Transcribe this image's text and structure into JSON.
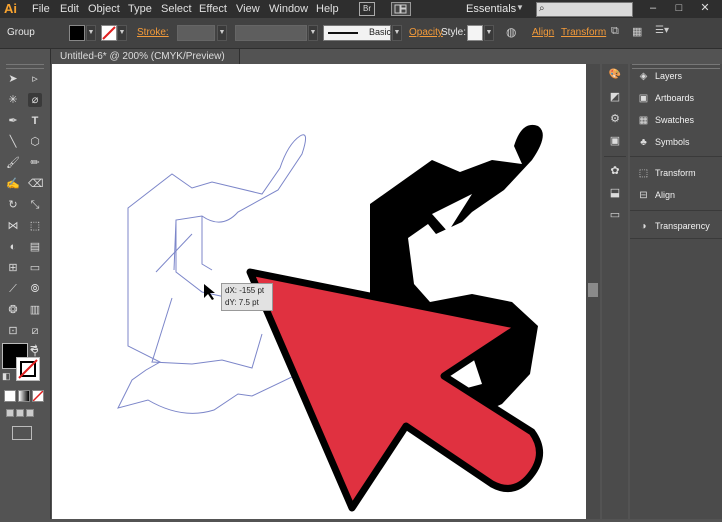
{
  "app": {
    "logo": "Ai"
  },
  "menu": {
    "items": [
      "File",
      "Edit",
      "Object",
      "Type",
      "Select",
      "Effect",
      "View",
      "Window",
      "Help"
    ],
    "br": "Br",
    "workspace": "Essentials"
  },
  "control_bar": {
    "selection": "Group",
    "stroke_label": "Stroke:",
    "stroke_style": "Basic",
    "opacity_label": "Opacity",
    "style_label": "Style:",
    "align_label": "Align",
    "transform_label": "Transform"
  },
  "document_tab": {
    "title": "Untitled-6* @ 200% (CMYK/Preview)"
  },
  "panels": {
    "group1": [
      "Layers",
      "Artboards",
      "Swatches",
      "Symbols"
    ],
    "group2": [
      "Transform",
      "Align"
    ],
    "group3": [
      "Transparency"
    ]
  },
  "tooltip": {
    "dx": "dX: -155 pt",
    "dy": "dY: 7.5 pt"
  },
  "colors": {
    "accent": "#f49b3a",
    "arrow": "#e03140"
  }
}
